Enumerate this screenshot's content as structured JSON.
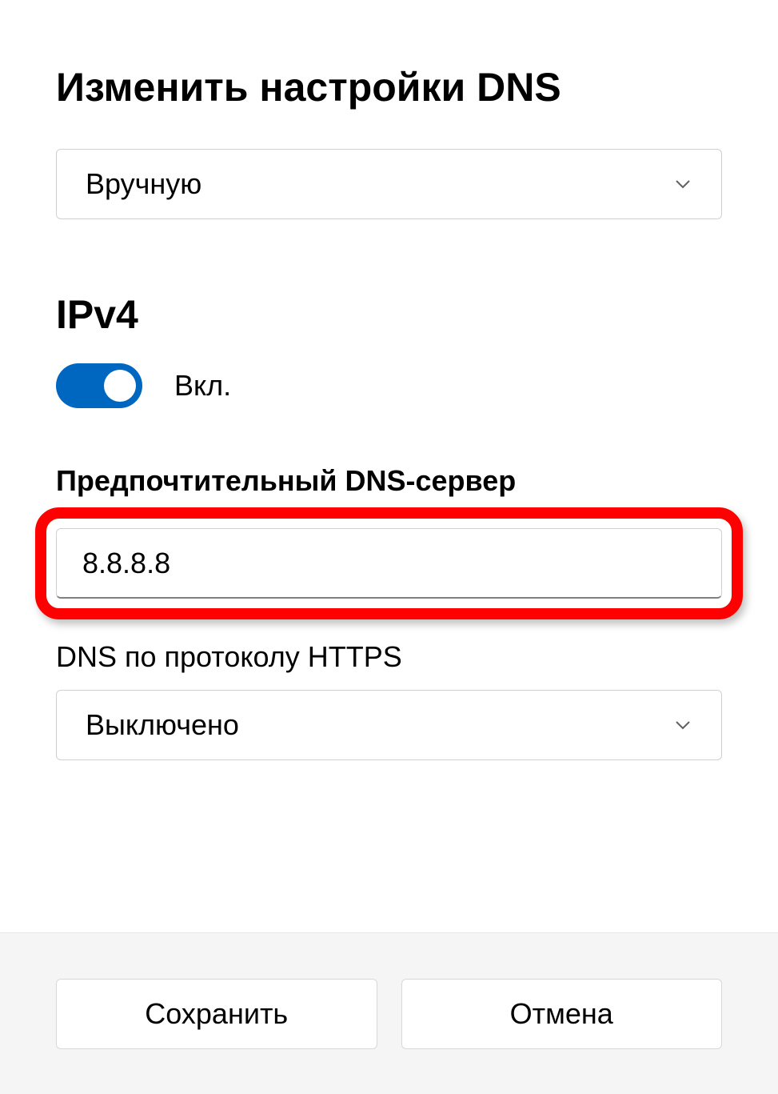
{
  "title": "Изменить настройки DNS",
  "mode_dropdown": {
    "selected": "Вручную"
  },
  "ipv4": {
    "heading": "IPv4",
    "toggle_state": "Вкл."
  },
  "preferred_dns": {
    "label": "Предпочтительный DNS-сервер",
    "value": "8.8.8.8"
  },
  "dns_over_https": {
    "label": "DNS по протоколу HTTPS",
    "selected": "Выключено"
  },
  "buttons": {
    "save": "Сохранить",
    "cancel": "Отмена"
  }
}
